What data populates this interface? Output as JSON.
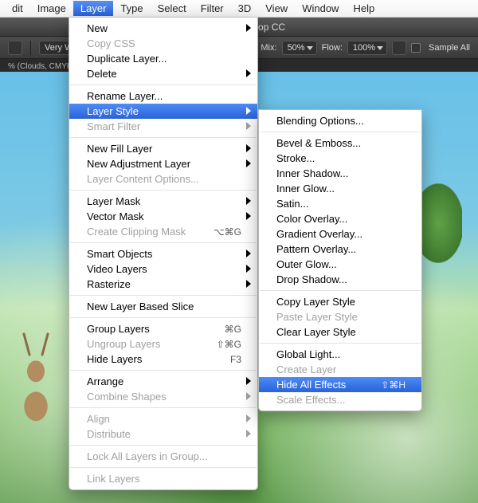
{
  "menubar": {
    "items": [
      "dit",
      "Image",
      "Layer",
      "Type",
      "Select",
      "Filter",
      "3D",
      "View",
      "Window",
      "Help"
    ],
    "active_index": 2
  },
  "titlebar": {
    "app": "Adobe Photoshop CC"
  },
  "optionsbar": {
    "sample_label_left": "Very W",
    "mix_label": "Mix:",
    "mix_value": "50%",
    "flow_label": "Flow:",
    "flow_value": "100%",
    "sample_all_label": "Sample All"
  },
  "tabbar": {
    "doc": "% (Clouds, CMYK"
  },
  "layer_menu": {
    "groups": [
      [
        {
          "label": "New",
          "sub": true
        },
        {
          "label": "Copy CSS",
          "disabled": true
        },
        {
          "label": "Duplicate Layer..."
        },
        {
          "label": "Delete",
          "sub": true
        }
      ],
      [
        {
          "label": "Rename Layer..."
        },
        {
          "label": "Layer Style",
          "sub": true,
          "highlight": true
        },
        {
          "label": "Smart Filter",
          "sub": true,
          "disabled": true
        }
      ],
      [
        {
          "label": "New Fill Layer",
          "sub": true
        },
        {
          "label": "New Adjustment Layer",
          "sub": true
        },
        {
          "label": "Layer Content Options...",
          "disabled": true
        }
      ],
      [
        {
          "label": "Layer Mask",
          "sub": true
        },
        {
          "label": "Vector Mask",
          "sub": true
        },
        {
          "label": "Create Clipping Mask",
          "shortcut": "⌥⌘G",
          "disabled": true
        }
      ],
      [
        {
          "label": "Smart Objects",
          "sub": true
        },
        {
          "label": "Video Layers",
          "sub": true
        },
        {
          "label": "Rasterize",
          "sub": true
        }
      ],
      [
        {
          "label": "New Layer Based Slice"
        }
      ],
      [
        {
          "label": "Group Layers",
          "shortcut": "⌘G"
        },
        {
          "label": "Ungroup Layers",
          "shortcut": "⇧⌘G",
          "disabled": true
        },
        {
          "label": "Hide Layers",
          "shortcut": "F3"
        }
      ],
      [
        {
          "label": "Arrange",
          "sub": true
        },
        {
          "label": "Combine Shapes",
          "sub": true,
          "disabled": true
        }
      ],
      [
        {
          "label": "Align",
          "sub": true,
          "disabled": true
        },
        {
          "label": "Distribute",
          "sub": true,
          "disabled": true
        }
      ],
      [
        {
          "label": "Lock All Layers in Group...",
          "disabled": true
        }
      ],
      [
        {
          "label": "Link Layers",
          "disabled": true
        }
      ]
    ]
  },
  "style_menu": {
    "groups": [
      [
        {
          "label": "Blending Options..."
        }
      ],
      [
        {
          "label": "Bevel & Emboss..."
        },
        {
          "label": "Stroke..."
        },
        {
          "label": "Inner Shadow..."
        },
        {
          "label": "Inner Glow..."
        },
        {
          "label": "Satin..."
        },
        {
          "label": "Color Overlay..."
        },
        {
          "label": "Gradient Overlay..."
        },
        {
          "label": "Pattern Overlay..."
        },
        {
          "label": "Outer Glow..."
        },
        {
          "label": "Drop Shadow..."
        }
      ],
      [
        {
          "label": "Copy Layer Style"
        },
        {
          "label": "Paste Layer Style",
          "disabled": true
        },
        {
          "label": "Clear Layer Style"
        }
      ],
      [
        {
          "label": "Global Light..."
        },
        {
          "label": "Create Layer",
          "disabled": true
        },
        {
          "label": "Hide All Effects",
          "shortcut": "⇧⌘H",
          "highlight": true
        },
        {
          "label": "Scale Effects...",
          "disabled": true
        }
      ]
    ]
  }
}
